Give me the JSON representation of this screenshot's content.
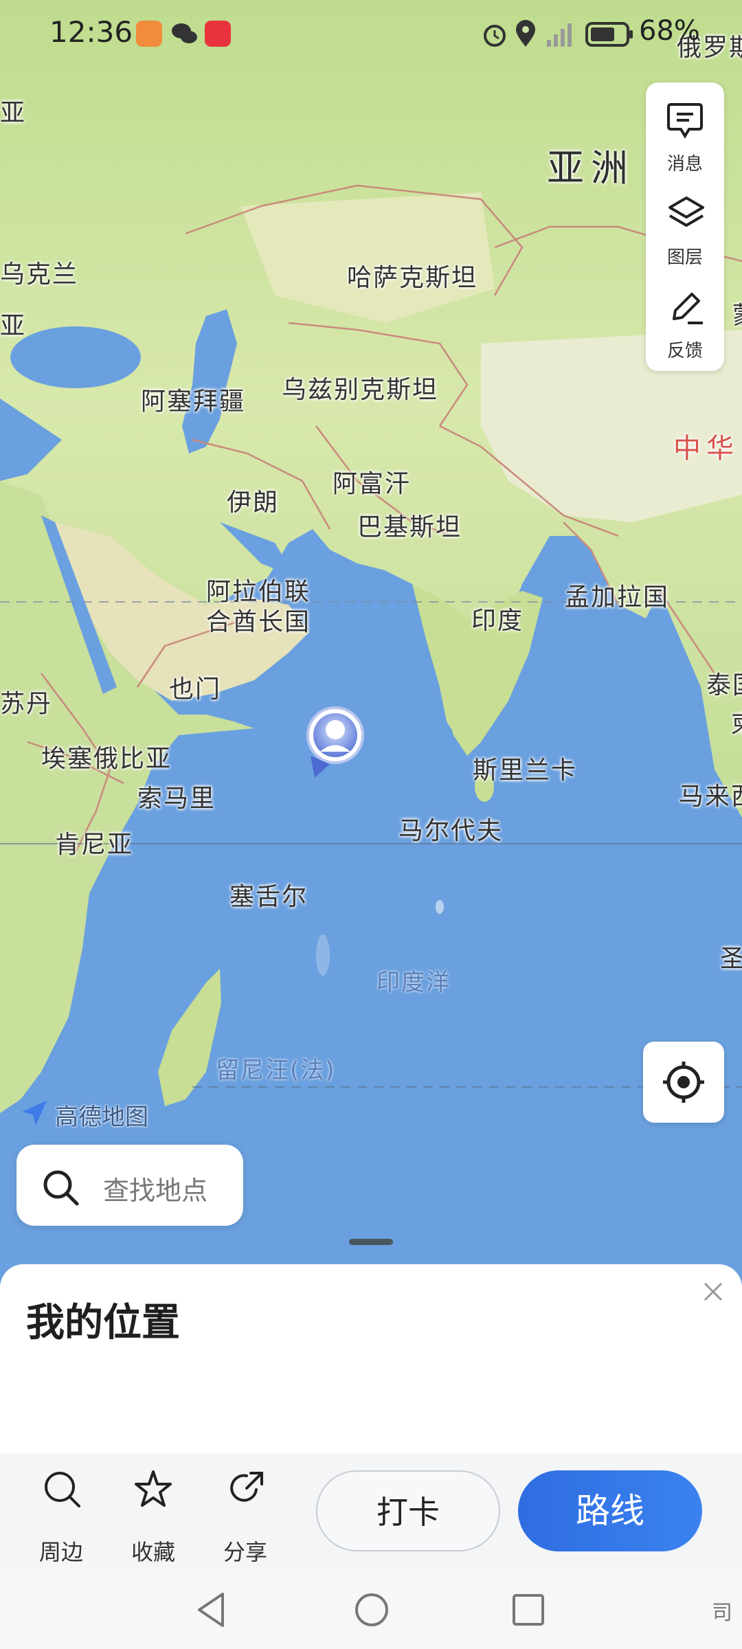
{
  "status_bar": {
    "time": "12:36",
    "battery": "68%"
  },
  "map_labels": {
    "asia": "亚洲",
    "russia": "俄罗斯",
    "china": "中华",
    "mongolia": "蒙",
    "kazakhstan": "哈萨克斯坦",
    "uzbekistan": "乌兹别克斯坦",
    "azerbaijan": "阿塞拜疆",
    "ukraine": "乌克兰",
    "ya_top": "亚",
    "ya_left": "亚",
    "iran": "伊朗",
    "afghanistan": "阿富汗",
    "pakistan": "巴基斯坦",
    "uae_1": "阿拉伯联",
    "uae_2": "合酋长国",
    "india": "印度",
    "bangladesh": "孟加拉国",
    "yemen": "也门",
    "sudan": "苏丹",
    "ethiopia": "埃塞俄比亚",
    "somalia": "索马里",
    "kenya": "肯尼亚",
    "sri_lanka": "斯里兰卡",
    "maldives": "马尔代夫",
    "seychelles": "塞舌尔",
    "indian_ocean": "印度洋",
    "reunion": "留尼汪(法)",
    "thailand": "泰国",
    "cambodia": "柬",
    "malaysia": "马来西",
    "sheng": "圣"
  },
  "side_panel": {
    "messages": "消息",
    "layers": "图层",
    "feedback": "反馈"
  },
  "map_logo": "高德地图",
  "search": {
    "placeholder": "查找地点"
  },
  "sheet": {
    "title": "我的位置"
  },
  "actions": {
    "nearby": "周边",
    "favorite": "收藏",
    "share": "分享",
    "checkin": "打卡",
    "route": "路线"
  },
  "nav_edge": "司",
  "colors": {
    "accent": "#2f6de0",
    "water": "#6aa0df",
    "land": "#cfe3a6"
  }
}
